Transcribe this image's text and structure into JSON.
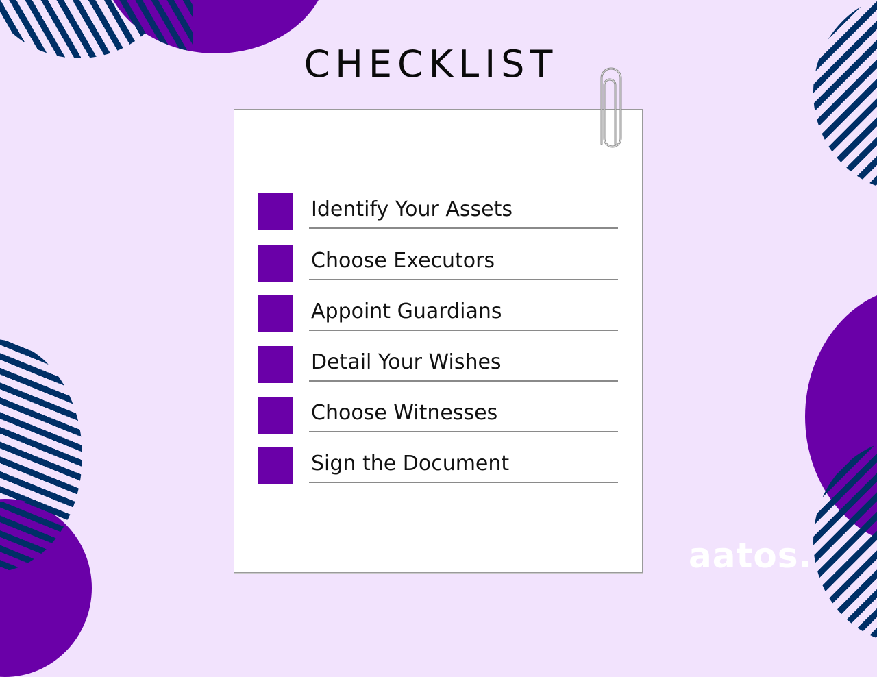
{
  "title": "CHECKLIST",
  "colors": {
    "background": "#f2e3fd",
    "accent_purple": "#6a00a8",
    "stripe_navy": "#002f66",
    "card": "#ffffff",
    "text": "#111111",
    "logo": "#ffffff"
  },
  "checklist": {
    "items": [
      {
        "label": "Identify Your Assets",
        "checked": false
      },
      {
        "label": "Choose Executors",
        "checked": false
      },
      {
        "label": "Appoint Guardians",
        "checked": false
      },
      {
        "label": "Detail Your Wishes",
        "checked": false
      },
      {
        "label": "Choose Witnesses",
        "checked": false
      },
      {
        "label": "Sign the Document",
        "checked": false
      }
    ]
  },
  "icons": {
    "clip": "paperclip-icon",
    "checkbox": "checkbox-square-icon"
  },
  "brand": {
    "logo_text": "aatos."
  }
}
